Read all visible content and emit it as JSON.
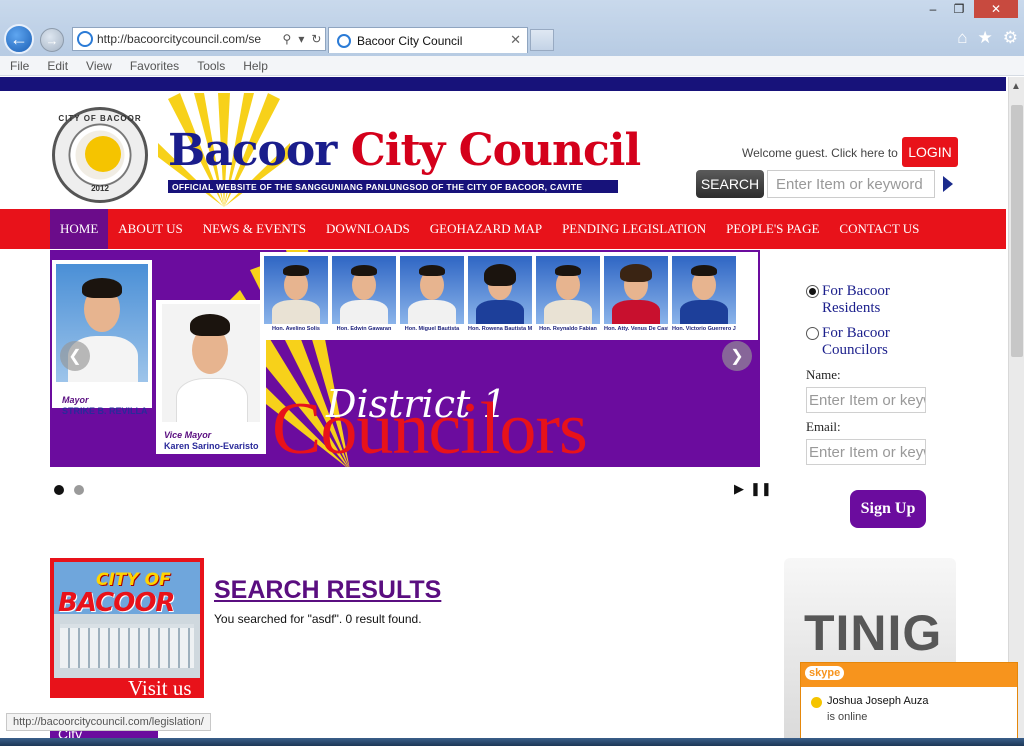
{
  "browser": {
    "address": "http://bacoorcitycouncil.com/se",
    "tab_title": "Bacoor City Council",
    "menu": [
      "File",
      "Edit",
      "View",
      "Favorites",
      "Tools",
      "Help"
    ],
    "window_controls": [
      "–",
      "❐",
      "✕"
    ],
    "toolbar_icons": [
      "home-icon",
      "star-icon",
      "gear-icon"
    ]
  },
  "header": {
    "seal_top": "CITY OF BACOOR",
    "seal_year": "2012",
    "title_part1": "Bacoor",
    "title_part2": "City Council",
    "subtitle": "OFFICIAL WEBSITE OF THE SANGGUNIANG PANLUNGSOD OF THE CITY OF BACOOR, CAVITE",
    "welcome": "Welcome guest. Click here to",
    "login_label": "LOGIN",
    "search_label": "SEARCH",
    "search_placeholder": "Enter Item or keyword"
  },
  "nav": {
    "items": [
      "HOME",
      "ABOUT US",
      "NEWS & EVENTS",
      "DOWNLOADS",
      "GEOHAZARD MAP",
      "PENDING LEGISLATION",
      "PEOPLE'S PAGE",
      "CONTACT US"
    ],
    "active": "HOME"
  },
  "slider": {
    "mayor_role": "Mayor",
    "mayor_name": "STRIKE B. REVILLA",
    "vice_role": "Vice Mayor",
    "vice_name": "Karen Sarino-Evaristo",
    "councilors": [
      "Hon. Avelino Solis",
      "Hon. Edwin Gawaran",
      "Hon. Miguel Bautista",
      "Hon. Rowena Bautista Mendiola",
      "Hon. Reynaldo Fabian",
      "Hon. Atty. Venus De Castro",
      "Hon. Victorio Guerrero Jr."
    ],
    "district_text": "District 1",
    "councilors_text": "Councilors",
    "slide_count": 2,
    "current_slide": 1
  },
  "signup": {
    "option_residents": "For Bacoor Residents",
    "option_councilors": "For Bacoor Councilors",
    "selected": "residents",
    "name_label": "Name:",
    "name_placeholder": "Enter Item or keyw",
    "email_label": "Email:",
    "email_placeholder": "Enter Item or keyw",
    "button_label": "Sign Up"
  },
  "content": {
    "visit_city": "CITY OF",
    "visit_bacoor": "BACOOR",
    "visit_us": "Visit us",
    "results_title": "SEARCH RESULTS",
    "results_text": "You searched for \"asdf\". 0 result found.",
    "tinig": "TINIG",
    "city_tab": "City",
    "status_url": "http://bacoorcitycouncil.com/legislation/"
  },
  "skype": {
    "brand": "skype",
    "contact": "Joshua Joseph Auza",
    "status": "is online"
  }
}
